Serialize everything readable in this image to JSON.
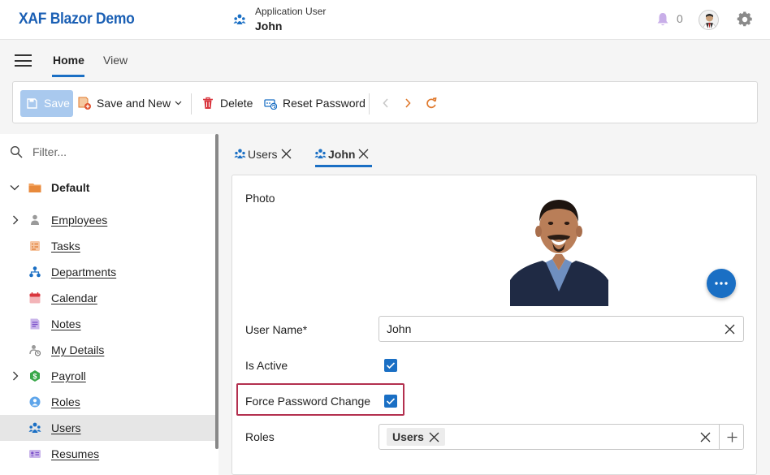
{
  "header": {
    "app_title": "XAF Blazor Demo",
    "user_caption": "Application User",
    "user_name": "John",
    "notifications_count": "0"
  },
  "ribbon": {
    "tabs": [
      {
        "label": "Home",
        "active": true
      },
      {
        "label": "View",
        "active": false
      }
    ]
  },
  "toolbar": {
    "save_label": "Save",
    "save_and_new_label": "Save and New",
    "delete_label": "Delete",
    "reset_password_label": "Reset Password"
  },
  "nav": {
    "filter_placeholder": "Filter...",
    "group_label": "Default",
    "items": [
      {
        "label": "Employees",
        "icon": "person-icon",
        "expandable": true
      },
      {
        "label": "Tasks",
        "icon": "tasks-icon",
        "expandable": false
      },
      {
        "label": "Departments",
        "icon": "org-chart-icon",
        "expandable": false
      },
      {
        "label": "Calendar",
        "icon": "calendar-icon",
        "expandable": false
      },
      {
        "label": "Notes",
        "icon": "notes-icon",
        "expandable": false
      },
      {
        "label": "My Details",
        "icon": "my-details-icon",
        "expandable": false
      },
      {
        "label": "Payroll",
        "icon": "payroll-icon",
        "expandable": true
      },
      {
        "label": "Roles",
        "icon": "role-icon",
        "expandable": false
      },
      {
        "label": "Users",
        "icon": "users-icon",
        "expandable": false,
        "selected": true
      },
      {
        "label": "Resumes",
        "icon": "resume-icon",
        "expandable": false
      }
    ]
  },
  "doc_tabs": [
    {
      "label": "Users",
      "active": false
    },
    {
      "label": "John",
      "active": true
    }
  ],
  "form": {
    "photo_label": "Photo",
    "user_name_label": "User Name*",
    "user_name_value": "John",
    "is_active_label": "Is Active",
    "is_active": true,
    "force_password_change_label": "Force Password Change",
    "force_password_change": true,
    "roles_label": "Roles",
    "roles": [
      "Users"
    ]
  },
  "colors": {
    "accent": "#1a6fc4",
    "title": "#1a5fb4",
    "highlight_border": "#b3304f"
  }
}
